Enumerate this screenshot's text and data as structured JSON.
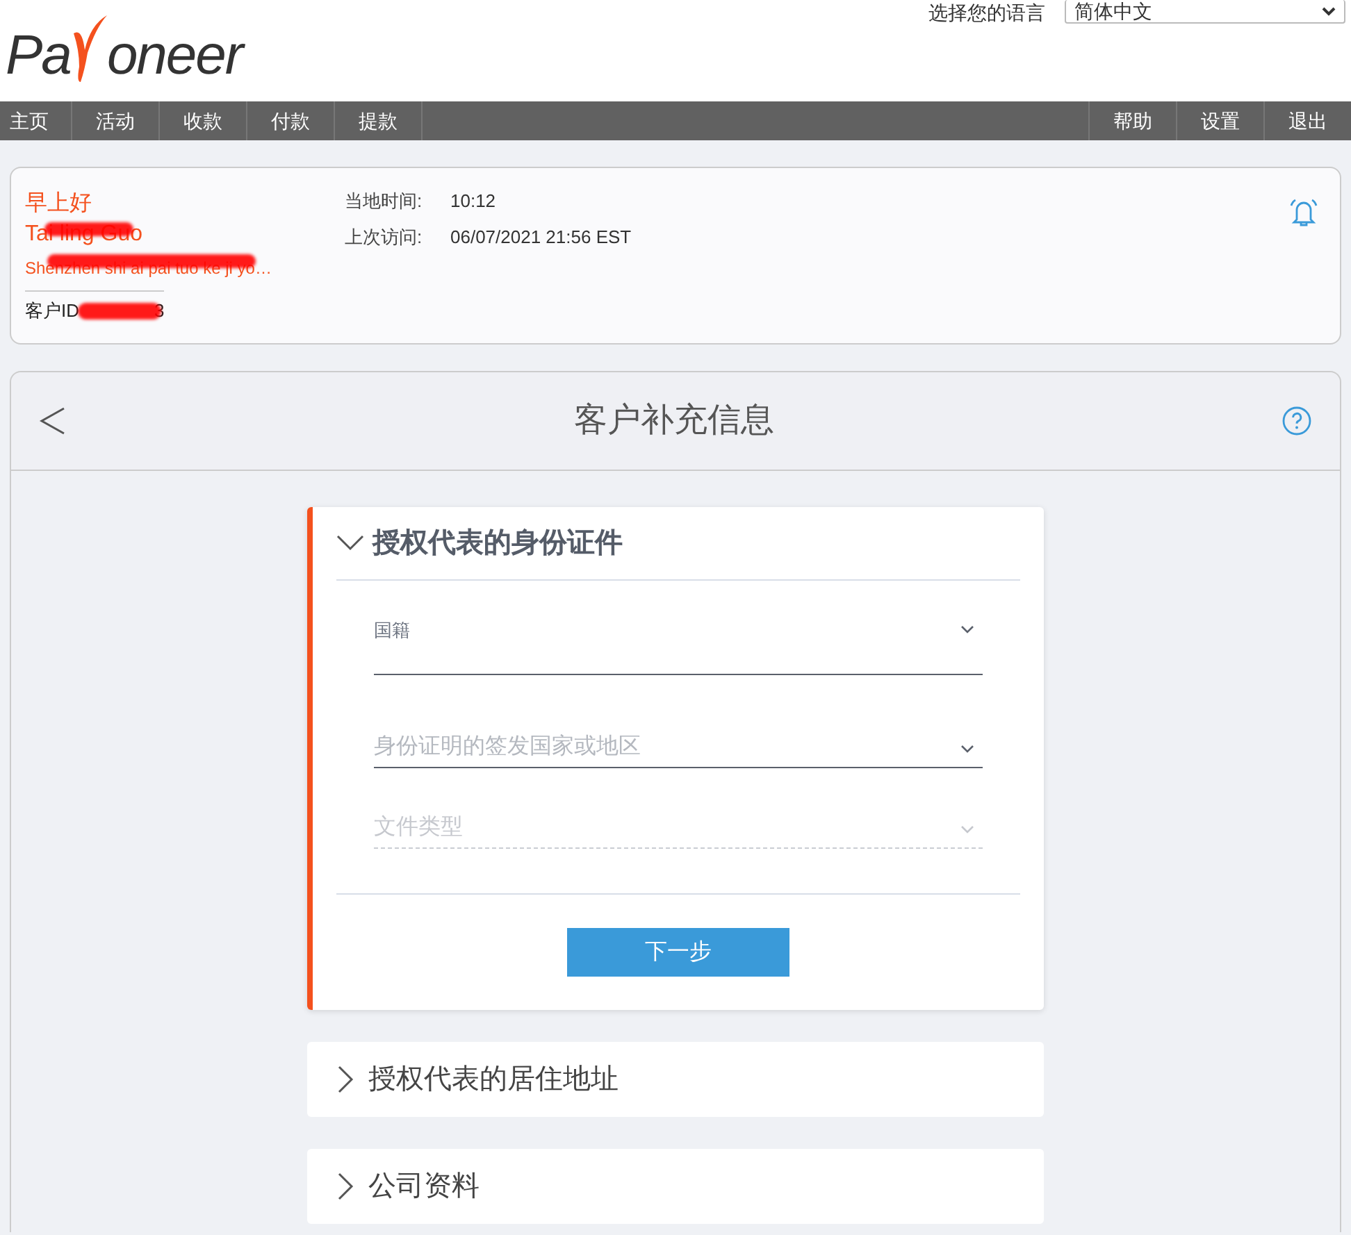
{
  "header": {
    "logo": {
      "before": "Pa",
      "after": "oneer"
    },
    "language_label": "选择您的语言",
    "language_value": "简体中文"
  },
  "nav": {
    "left": [
      {
        "label": "主页"
      },
      {
        "label": "活动"
      },
      {
        "label": "收款"
      },
      {
        "label": "付款"
      },
      {
        "label": "提款"
      }
    ],
    "right": [
      {
        "label": "帮助"
      },
      {
        "label": "设置"
      },
      {
        "label": "退出"
      }
    ]
  },
  "account": {
    "greeting": "早上好",
    "name": "Tai ling Guo",
    "company": "Shenzhen shi ai pai tuo ke ji yo…",
    "customer_id_label": "客户ID",
    "customer_id_visible": "3",
    "redacted": true,
    "info": [
      {
        "label": "当地时间:",
        "value": "10:12"
      },
      {
        "label": "上次访问:",
        "value": "06/07/2021 21:56 EST"
      }
    ]
  },
  "page": {
    "title": "客户补充信息"
  },
  "sections": [
    {
      "title": "授权代表的身份证件",
      "expanded": true,
      "fields": [
        {
          "label": "国籍",
          "floated": true,
          "disabled": false
        },
        {
          "label": "身份证明的签发国家或地区",
          "floated": false,
          "disabled": false
        },
        {
          "label": "文件类型",
          "floated": false,
          "disabled": true
        }
      ],
      "button": "下一步"
    },
    {
      "title": "授权代表的居住地址",
      "expanded": false
    },
    {
      "title": "公司资料",
      "expanded": false
    }
  ]
}
